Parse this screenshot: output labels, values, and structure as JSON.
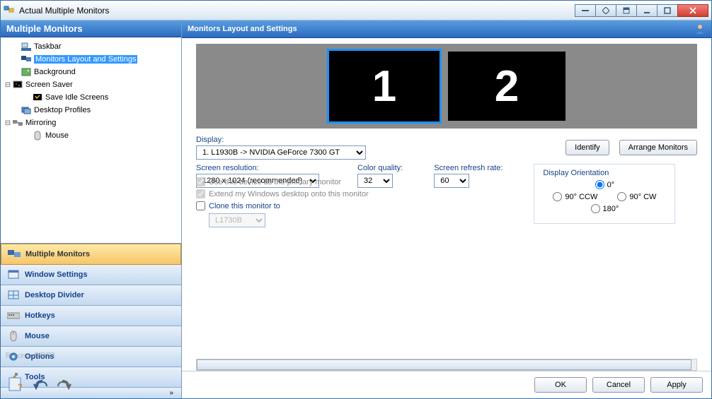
{
  "window": {
    "title": "Actual Multiple Monitors"
  },
  "left": {
    "header": "Multiple Monitors",
    "tree": {
      "taskbar": "Taskbar",
      "monitors_layout": "Monitors Layout and Settings",
      "background": "Background",
      "screen_saver": "Screen Saver",
      "save_idle": "Save Idle Screens",
      "desktop_profiles": "Desktop Profiles",
      "mirroring": "Mirroring",
      "mouse": "Mouse"
    },
    "nav": {
      "multiple_monitors": "Multiple Monitors",
      "window_settings": "Window Settings",
      "desktop_divider": "Desktop Divider",
      "hotkeys": "Hotkeys",
      "mouse": "Mouse",
      "options": "Options",
      "tools": "Tools"
    }
  },
  "right": {
    "header": "Monitors Layout and Settings",
    "monitors": {
      "m1": "1",
      "m2": "2"
    },
    "labels": {
      "display": "Display:",
      "identify": "Identify",
      "arrange": "Arrange Monitors",
      "screen_res": "Screen resolution:",
      "color_quality": "Color quality:",
      "refresh_rate": "Screen refresh rate:",
      "orientation": "Display Orientation",
      "primary": "Use this device as the primary monitor",
      "extend": "Extend my Windows desktop onto this monitor",
      "clone": "Clone this monitor to"
    },
    "values": {
      "display": "1. L1930B -> NVIDIA GeForce 7300 GT",
      "resolution": "1280 x 1024 (recommended)",
      "color": "32",
      "refresh": "60",
      "clone_target": "L1730B"
    },
    "orientation": {
      "o0": "0°",
      "o90ccw": "90° CCW",
      "o90cw": "90° CW",
      "o180": "180°"
    }
  },
  "buttons": {
    "ok": "OK",
    "cancel": "Cancel",
    "apply": "Apply"
  },
  "watermark": {
    "main": "filehorse",
    "suffix": ".com"
  }
}
